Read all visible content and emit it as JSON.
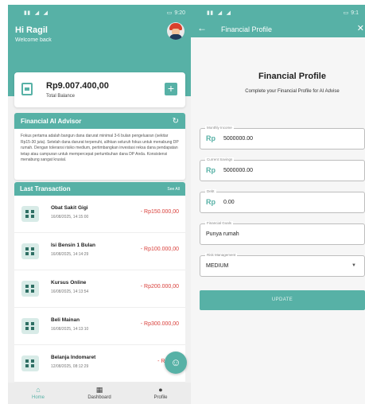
{
  "home": {
    "status": {
      "time": "9:20"
    },
    "greeting": "Hi Ragil",
    "welcome": "Welcome back",
    "balance": {
      "amount": "Rp9.007.400,00",
      "label": "Total Balance",
      "add": "+"
    },
    "advisor": {
      "title": "Financial AI Advisor",
      "text": "Fokus pertama adalah bangun dana darurat minimal 3-6 bulan pengeluaran (sekitar Rp15-30 juta). Setelah dana darurat terpenuhi, alihkan seluruh fokus untuk menabung DP rumah. Dengan toleransi risiko medium, pertimbangkan investasi reksa dana pendapatan tetap atau campuran untuk mempercepat pertumbuhan dana DP Anda. Konsistensi menabung sangat krusial."
    },
    "transactions": {
      "title": "Last Transaction",
      "see_all": "See All",
      "items": [
        {
          "name": "Obat Sakit Gigi",
          "date": "16/08/2025, 14:15:00",
          "amount": "- Rp150.000,00"
        },
        {
          "name": "Isi Bensin 1 Bulan",
          "date": "16/08/2025, 14:14:29",
          "amount": "- Rp100.000,00"
        },
        {
          "name": "Kursus Online",
          "date": "16/08/2025, 14:13:54",
          "amount": "- Rp200.000,00"
        },
        {
          "name": "Beli Mainan",
          "date": "16/08/2025, 14:13:10",
          "amount": "- Rp300.000,00"
        },
        {
          "name": "Belanja Indomaret",
          "date": "12/08/2025, 08:12:29",
          "amount": "- Rp157."
        }
      ]
    },
    "nav": {
      "home": "Home",
      "dashboard": "Dashboard",
      "profile": "Profile"
    }
  },
  "profile": {
    "status": {
      "time": "9:1"
    },
    "appbar_title": "Financial Profile",
    "title": "Financial Profile",
    "subtitle": "Complete your Financial Profile for AI Advise",
    "currency": "Rp",
    "fields": {
      "income": {
        "label": "Monthly Income",
        "value": "5000000.00"
      },
      "savings": {
        "label": "Current Savings",
        "value": "5000000.00"
      },
      "debt": {
        "label": "Debt",
        "value": "0.00"
      },
      "goals": {
        "label": "Financial Goals",
        "value": "Punya rumah"
      },
      "risk": {
        "label": "Risk Management",
        "value": "MEDIUM"
      }
    },
    "update_label": "UPDATE"
  },
  "colors": {
    "primary": "#57b1a6",
    "expense": "#d9413c"
  }
}
